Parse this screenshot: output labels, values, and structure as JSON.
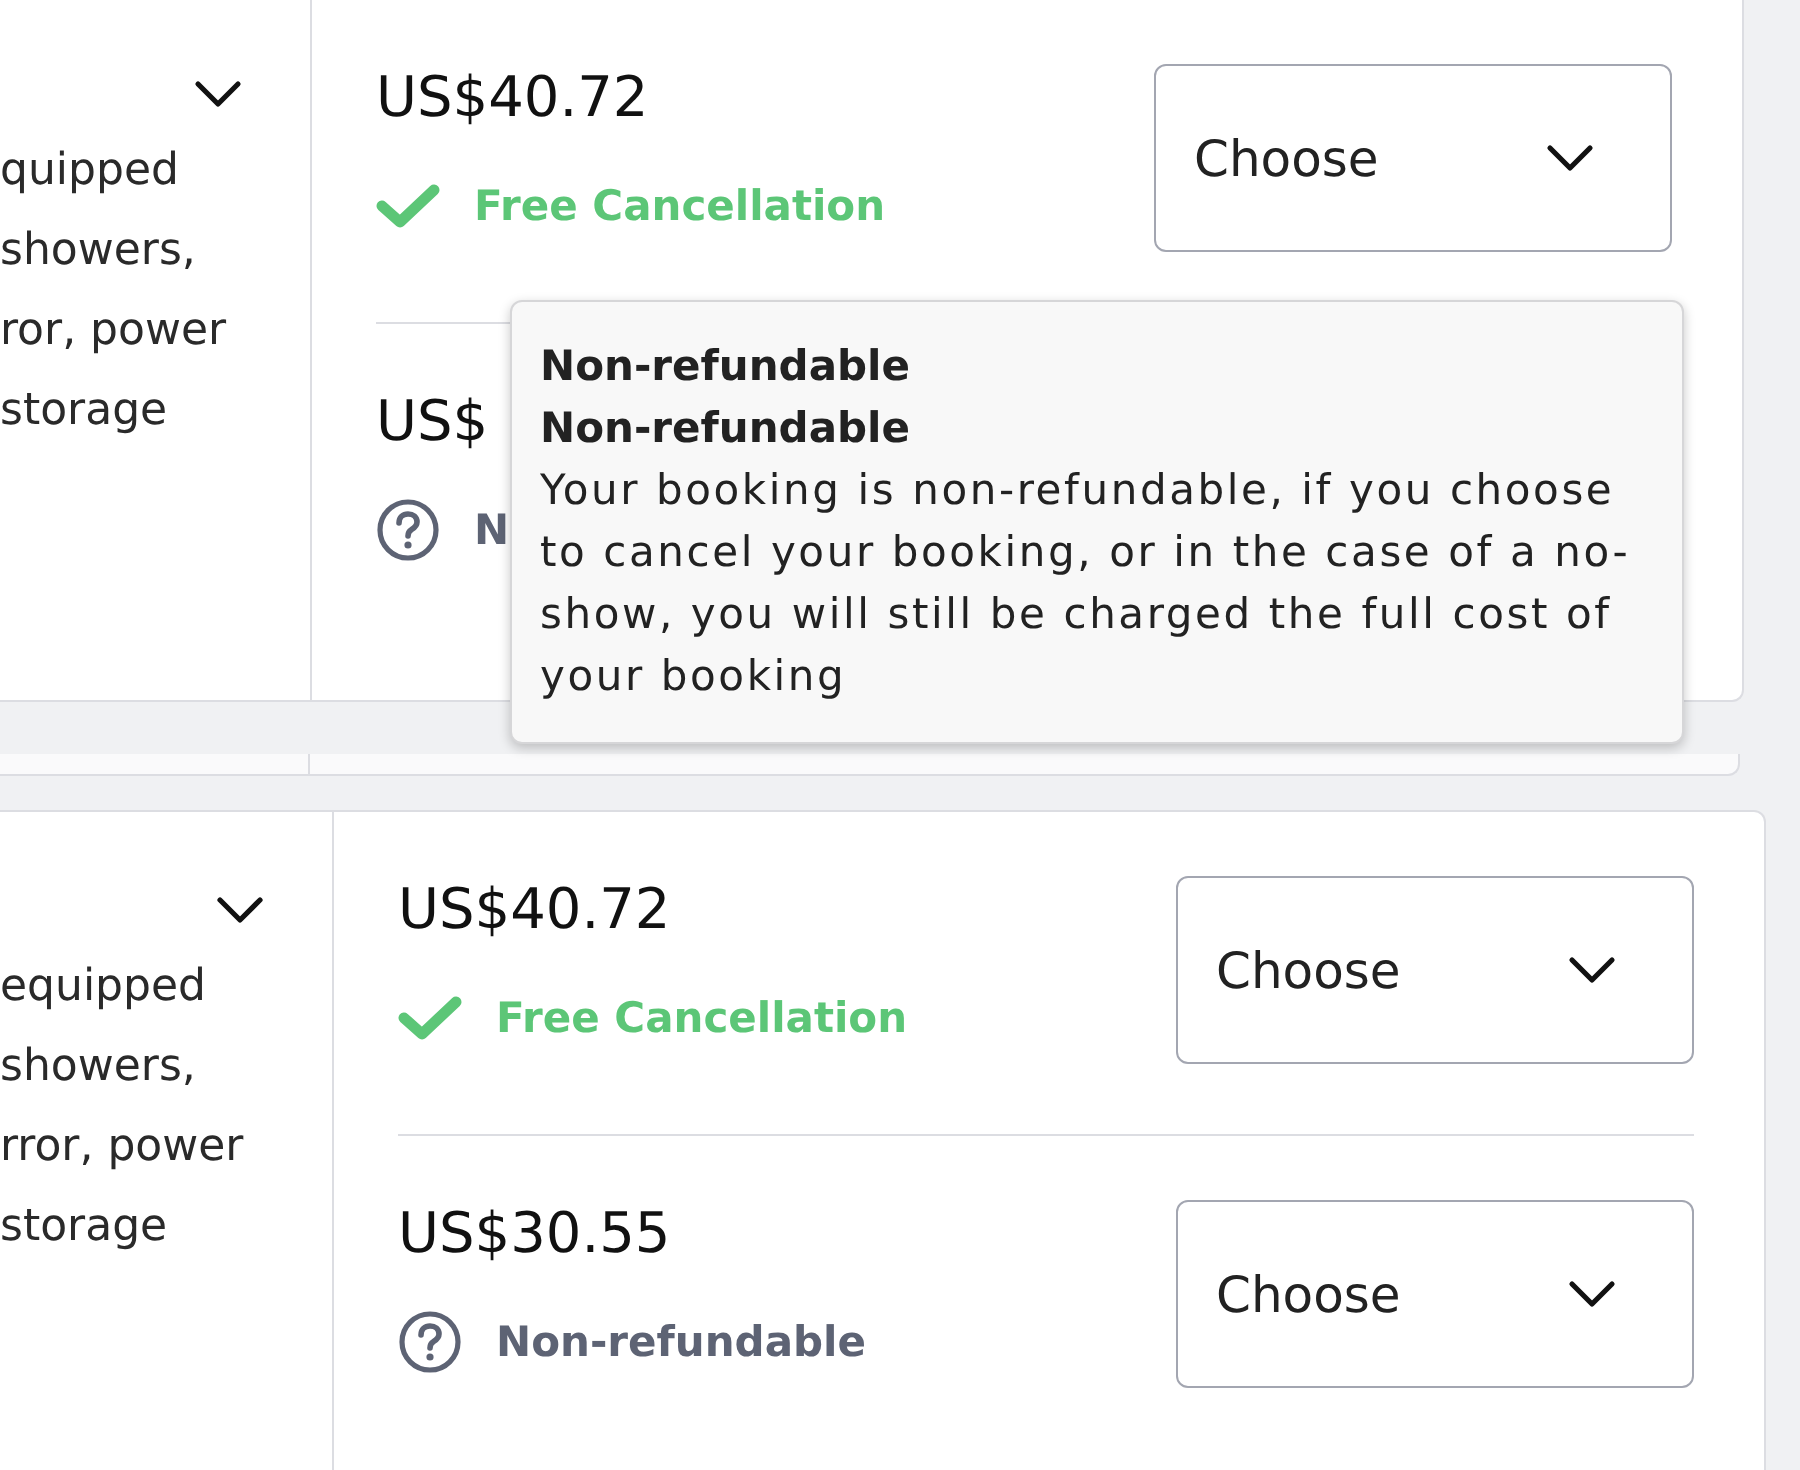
{
  "cards": [
    {
      "description_lines": [
        "quipped",
        "showers,",
        "ror, power",
        "storage"
      ],
      "options": [
        {
          "price": "US$40.72",
          "policy": {
            "kind": "free",
            "label": "Free Cancellation"
          },
          "select": {
            "value": "Choose"
          }
        },
        {
          "price": "US$",
          "policy": {
            "kind": "nonrefundable",
            "label": "N"
          }
        }
      ]
    },
    {
      "description_lines": [
        "equipped",
        "showers,",
        "rror, power",
        "storage"
      ],
      "options": [
        {
          "price": "US$40.72",
          "policy": {
            "kind": "free",
            "label": "Free Cancellation"
          },
          "select": {
            "value": "Choose"
          }
        },
        {
          "price": "US$30.55",
          "policy": {
            "kind": "nonrefundable",
            "label": "Non-refundable"
          },
          "select": {
            "value": "Choose"
          }
        }
      ]
    }
  ],
  "tooltip": {
    "headings": [
      "Non-refundable",
      "Non-refundable"
    ],
    "text": "Your booking is non-refundable, if you choose to cancel your booking, or in the case of a no-show, you will still be charged the full cost of your booking"
  }
}
